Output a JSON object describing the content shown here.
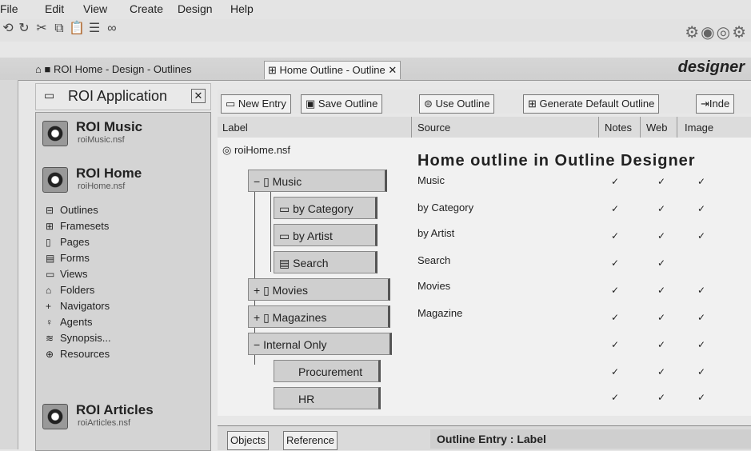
{
  "menu": [
    "File",
    "Edit",
    "View",
    "Create",
    "Design",
    "Help"
  ],
  "tabs": {
    "home_label": "ROI Home - Design - Outlines",
    "active_label": "Home Outline - Outline",
    "brand": "designer"
  },
  "app": {
    "title": "ROI Application"
  },
  "databases": [
    {
      "title": "ROI Music",
      "file": "roiMusic.nsf"
    },
    {
      "title": "ROI Home",
      "file": "roiHome.nsf"
    },
    {
      "title": "ROI Articles",
      "file": "roiArticles.nsf"
    }
  ],
  "design_items": [
    "Outlines",
    "Framesets",
    "Pages",
    "Forms",
    "Views",
    "Folders",
    "Navigators",
    "Agents",
    "Synopsis...",
    "Resources"
  ],
  "actions": [
    "New Entry",
    "Save Outline",
    "Use Outline",
    "Generate Default Outline",
    "Inde"
  ],
  "columns": {
    "label": "Label",
    "source": "Source",
    "notes": "Notes",
    "web": "Web",
    "image": "Image"
  },
  "root": "roiHome.nsf",
  "heading": "Home outline in Outline Designer",
  "entries": [
    {
      "label": "Music",
      "source": "Music",
      "notes": "✓",
      "web": "✓",
      "image": "✓"
    },
    {
      "label": "by Category",
      "source": "by Category",
      "notes": "✓",
      "web": "✓",
      "image": "✓"
    },
    {
      "label": "by Artist",
      "source": "by Artist",
      "notes": "✓",
      "web": "✓",
      "image": "✓"
    },
    {
      "label": "Search",
      "source": "Search",
      "notes": "✓",
      "web": "✓",
      "image": ""
    },
    {
      "label": "Movies",
      "source": "Movies",
      "notes": "✓",
      "web": "✓",
      "image": "✓"
    },
    {
      "label": "Magazines",
      "source": "Magazine",
      "notes": "✓",
      "web": "✓",
      "image": "✓"
    },
    {
      "label": "Internal Only",
      "source": "",
      "notes": "✓",
      "web": "✓",
      "image": "✓"
    },
    {
      "label": "Procurement",
      "source": "",
      "notes": "✓",
      "web": "✓",
      "image": "✓"
    },
    {
      "label": "HR",
      "source": "",
      "notes": "✓",
      "web": "✓",
      "image": "✓"
    }
  ],
  "bottom": {
    "objects": "Objects",
    "reference": "Reference",
    "entry_label": "Outline Entry : Label"
  }
}
